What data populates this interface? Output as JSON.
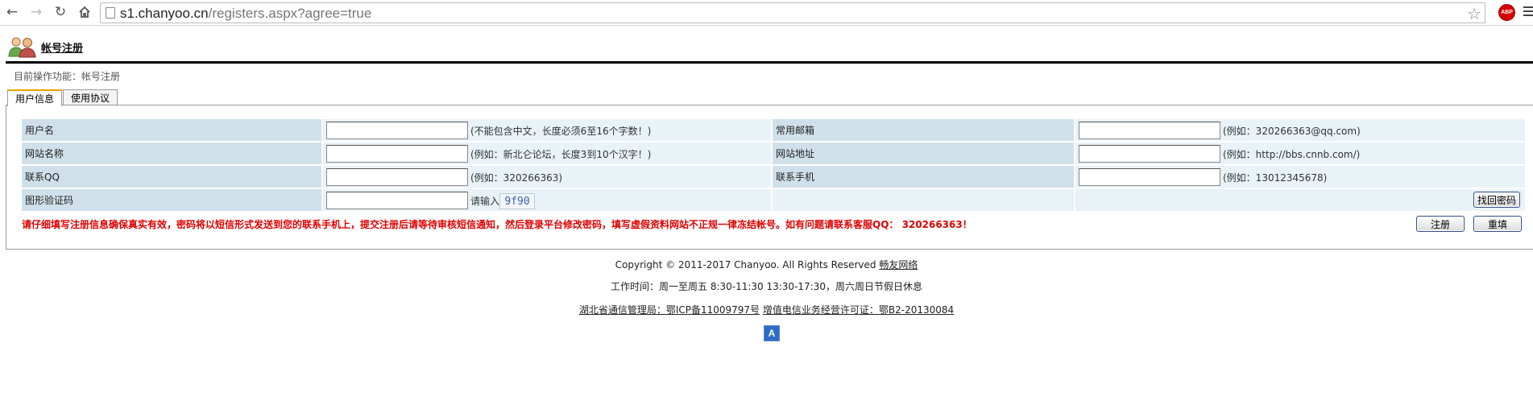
{
  "browser": {
    "url_host": "s1.chanyoo.cn",
    "url_path": "/registers.aspx?agree=true",
    "abp_label": "ABP"
  },
  "header": {
    "title": "帐号注册",
    "current_operation": "目前操作功能：帐号注册"
  },
  "tabs": [
    {
      "label": "用户信息",
      "active": true
    },
    {
      "label": "使用协议",
      "active": false
    }
  ],
  "form": {
    "username": {
      "label": "用户名",
      "value": "",
      "hint": "(不能包含中文，长度必须6至16个字数！)"
    },
    "email": {
      "label": "常用邮箱",
      "value": "",
      "hint": "(例如：320266363@qq.com)"
    },
    "site_name": {
      "label": "网站名称",
      "value": "",
      "hint": "(例如：新北仑论坛，长度3到10个汉字！)"
    },
    "site_url": {
      "label": "网站地址",
      "value": "",
      "hint": "(例如：http://bbs.cnnb.com/)"
    },
    "qq": {
      "label": "联系QQ",
      "value": "",
      "hint": "(例如：320266363)"
    },
    "mobile": {
      "label": "联系手机",
      "value": "",
      "hint": "(例如：13012345678)"
    },
    "captcha": {
      "label": "图形验证码",
      "value": "",
      "prompt": "请输入",
      "code": "9f90"
    }
  },
  "buttons": {
    "recover_password": "找回密码",
    "register": "注册",
    "reset": "重填"
  },
  "warning": "请仔细填写注册信息确保真实有效，密码将以短信形式发送到您的联系手机上，提交注册后请等待审核短信通知，然后登录平台修改密码，填写虚假资料网站不正规一律冻结帐号。如有问题请联系客服QQ： 320266363！",
  "footer": {
    "copyright": "Copyright © 2011-2017 Chanyoo. All Rights Reserved ",
    "company_link": "畅友网络",
    "hours": "工作时间：周一至周五 8:30-11:30 13:30-17:30，周六周日节假日休息",
    "authority": "湖北省通信管理局：",
    "icp": "鄂ICP备11009797号",
    "license_label": "增值电信业务经营许可证：",
    "license": "鄂B2-20130084",
    "badge": "A"
  }
}
